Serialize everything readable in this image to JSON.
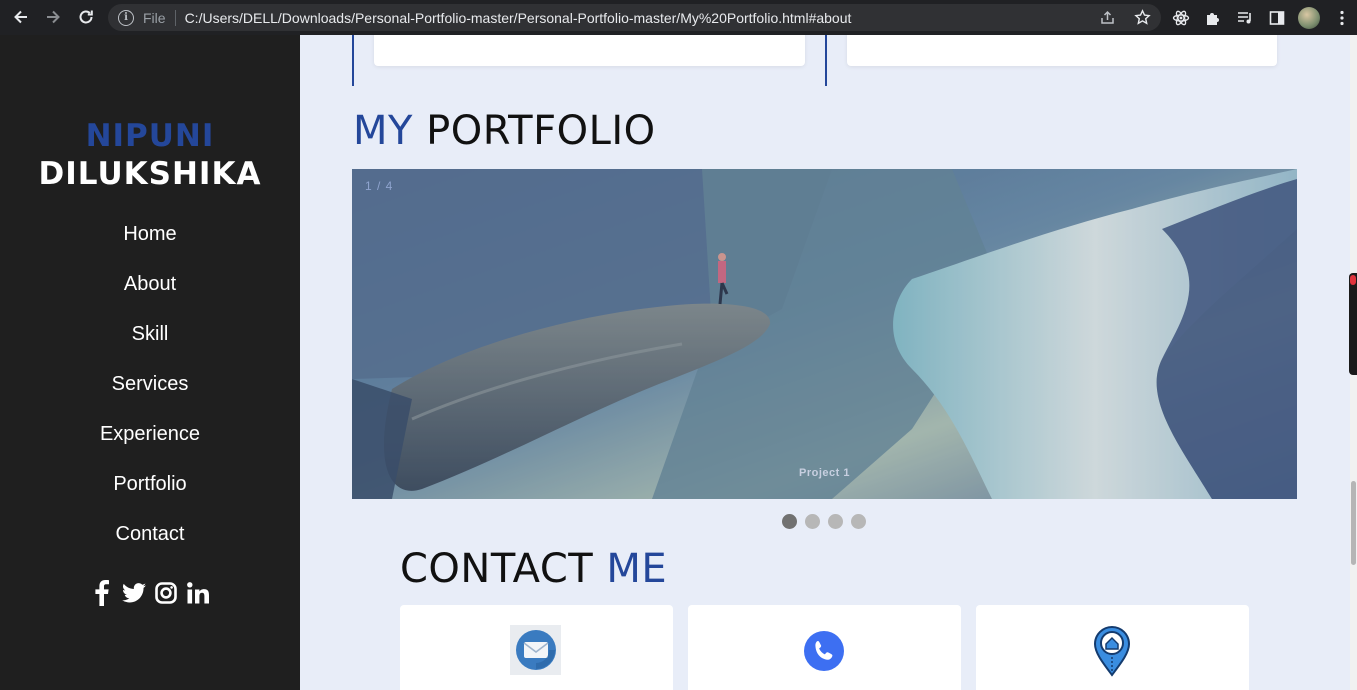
{
  "browser": {
    "scheme_label": "File",
    "url": "C:/Users/DELL/Downloads/Personal-Portfolio-master/Personal-Portfolio-master/My%20Portfolio.html#about"
  },
  "sidebar": {
    "first_name": "NIPUNI",
    "last_name": "DILUKSHIKA",
    "menu": [
      {
        "label": "Home"
      },
      {
        "label": "About"
      },
      {
        "label": "Skill"
      },
      {
        "label": "Services"
      },
      {
        "label": "Experience"
      },
      {
        "label": "Portfolio"
      },
      {
        "label": "Contact"
      }
    ],
    "socials": [
      "facebook-icon",
      "twitter-icon",
      "instagram-icon",
      "linkedin-icon"
    ]
  },
  "portfolio": {
    "title_accent": "MY",
    "title_rest": "PORTFOLIO",
    "slide_counter": "1 / 4",
    "slide_caption": "Project 1",
    "slide_count": 4,
    "active_slide": 1
  },
  "contact": {
    "title_plain": "CONTACT",
    "title_accent": "ME",
    "cards": [
      "email-icon",
      "phone-icon",
      "location-icon"
    ]
  },
  "colors": {
    "accent": "#24479a",
    "sidebar_bg": "#1f1f1f",
    "page_bg": "#e8edf8"
  }
}
